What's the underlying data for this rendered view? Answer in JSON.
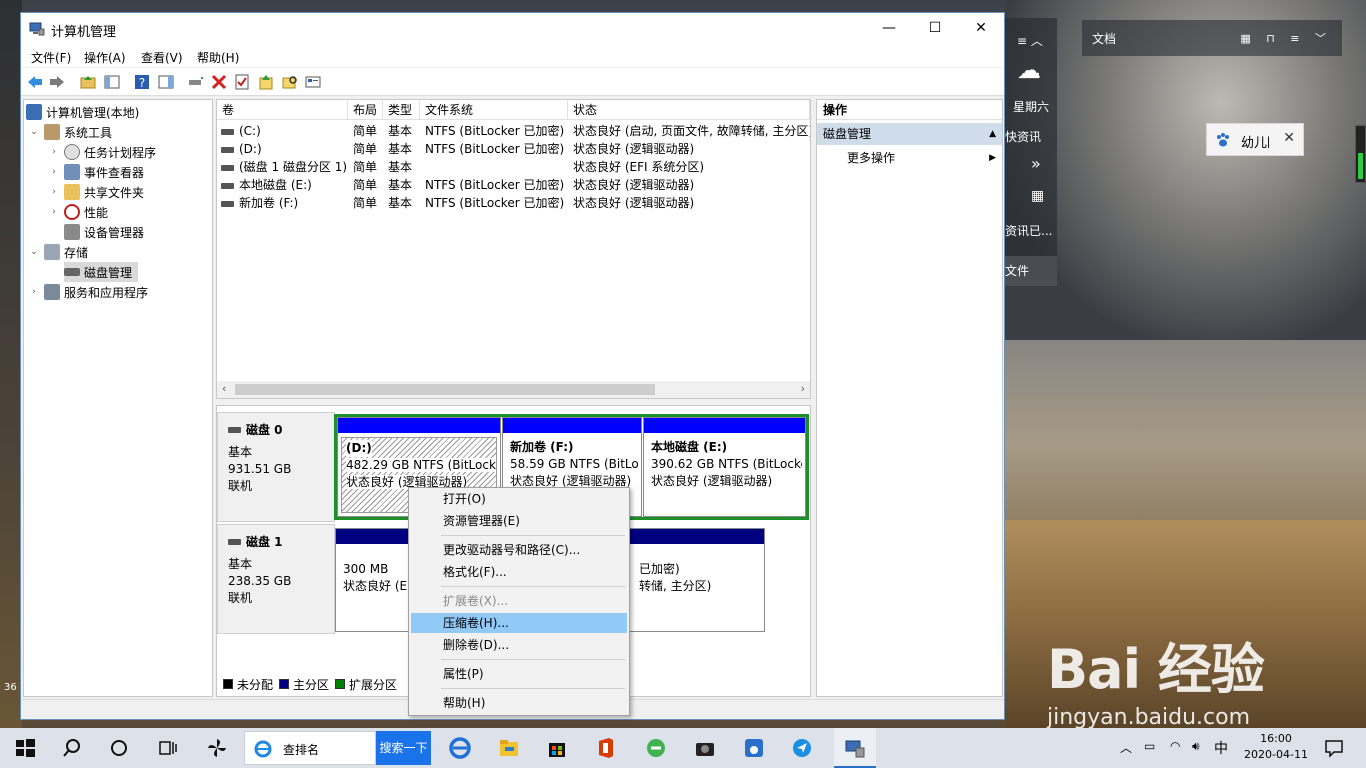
{
  "window": {
    "title": "计算机管理",
    "menu": [
      "文件(F)",
      "操作(A)",
      "查看(V)",
      "帮助(H)"
    ],
    "controls": {
      "minimize": "—",
      "maximize": "☐",
      "close": "✕"
    }
  },
  "tree": {
    "items": [
      {
        "label": "计算机管理(本地)",
        "icon": "computer-management-icon"
      },
      {
        "label": "系统工具",
        "icon": "system-tools-icon",
        "expanded": true
      },
      {
        "label": "任务计划程序",
        "icon": "task-scheduler-icon"
      },
      {
        "label": "事件查看器",
        "icon": "event-viewer-icon"
      },
      {
        "label": "共享文件夹",
        "icon": "shared-folders-icon"
      },
      {
        "label": "性能",
        "icon": "performance-icon"
      },
      {
        "label": "设备管理器",
        "icon": "device-manager-icon"
      },
      {
        "label": "存储",
        "icon": "storage-icon",
        "expanded": true
      },
      {
        "label": "磁盘管理",
        "icon": "disk-management-icon",
        "selected": true
      },
      {
        "label": "服务和应用程序",
        "icon": "services-icon"
      }
    ]
  },
  "volumes": {
    "headers": [
      "卷",
      "布局",
      "类型",
      "文件系统",
      "状态"
    ],
    "rows": [
      {
        "vol": "(C:)",
        "layout": "简单",
        "type": "基本",
        "fs": "NTFS (BitLocker 已加密)",
        "status": "状态良好 (启动, 页面文件, 故障转储, 主分区)"
      },
      {
        "vol": "(D:)",
        "layout": "简单",
        "type": "基本",
        "fs": "NTFS (BitLocker 已加密)",
        "status": "状态良好 (逻辑驱动器)"
      },
      {
        "vol": "(磁盘 1 磁盘分区 1)",
        "layout": "简单",
        "type": "基本",
        "fs": "",
        "status": "状态良好 (EFI 系统分区)"
      },
      {
        "vol": "本地磁盘 (E:)",
        "layout": "简单",
        "type": "基本",
        "fs": "NTFS (BitLocker 已加密)",
        "status": "状态良好 (逻辑驱动器)"
      },
      {
        "vol": "新加卷 (F:)",
        "layout": "简单",
        "type": "基本",
        "fs": "NTFS (BitLocker 已加密)",
        "status": "状态良好 (逻辑驱动器)"
      }
    ]
  },
  "disks": {
    "disk0": {
      "name": "磁盘 0",
      "type": "基本",
      "size": "931.51 GB",
      "state": "联机",
      "partitions": [
        {
          "title": "(D:)",
          "detail": "482.29 GB NTFS (BitLocke",
          "status": "状态良好 (逻辑驱动器)"
        },
        {
          "title": "新加卷  (F:)",
          "detail": "58.59 GB NTFS (BitLo",
          "status": "状态良好 (逻辑驱动器)"
        },
        {
          "title": "本地磁盘  (E:)",
          "detail": "390.62 GB NTFS (BitLocke",
          "status": "状态良好 (逻辑驱动器)"
        }
      ]
    },
    "disk1": {
      "name": "磁盘 1",
      "type": "基本",
      "size": "238.35 GB",
      "state": "联机",
      "partitions": [
        {
          "detail": "300 MB",
          "status": "状态良好 (EF"
        },
        {
          "detail": "已加密)",
          "status": "转储, 主分区)"
        }
      ]
    },
    "legend": [
      "未分配",
      "主分区",
      "扩展分区"
    ],
    "legend_colors": [
      "#000000",
      "#000080",
      "#008000"
    ]
  },
  "actions": {
    "header": "操作",
    "section": "磁盘管理",
    "more": "更多操作"
  },
  "context_menu": {
    "items": [
      "打开(O)",
      "资源管理器(E)",
      "更改驱动器号和路径(C)...",
      "格式化(F)...",
      "扩展卷(X)...",
      "压缩卷(H)...",
      "删除卷(D)...",
      "属性(P)",
      "帮助(H)"
    ],
    "highlighted": "压缩卷(H)...",
    "disabled": [
      "扩展卷(X)..."
    ]
  },
  "desktop": {
    "doc_panel_title": "文档",
    "weekday": "星期六",
    "widget_items": [
      "快资讯",
      "资讯已...",
      "文件"
    ],
    "toast_text": "幼儿园",
    "watermark_main": "Bai 经验",
    "watermark_url": "jingyan.baidu.com",
    "left_edge_number": "36"
  },
  "taskbar": {
    "search_text": "查排名",
    "search_button": "搜索一下",
    "ime": "中",
    "time": "16:00",
    "date": "2020-04-11",
    "accent": "#1a73e8"
  }
}
